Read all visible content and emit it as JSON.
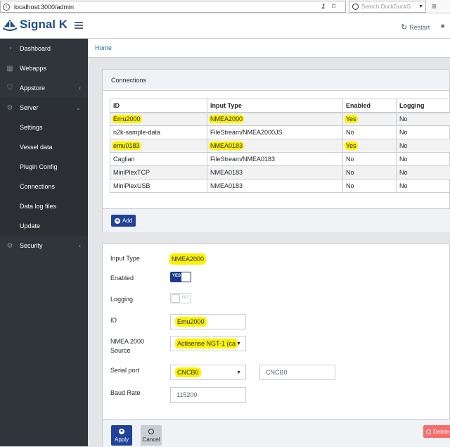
{
  "browser": {
    "url": "localhost:3000/admin",
    "search_placeholder": "Search DuckDuckG"
  },
  "header": {
    "brand": "Signal K",
    "restart": "Restart"
  },
  "sidebar": {
    "items": [
      {
        "label": "Dashboard",
        "icon": "speedometer-icon"
      },
      {
        "label": "Webapps",
        "icon": "grid-icon"
      },
      {
        "label": "Appstore",
        "icon": "basket-icon"
      },
      {
        "label": "Server",
        "icon": "gear-icon"
      },
      {
        "label": "Settings"
      },
      {
        "label": "Vessel data"
      },
      {
        "label": "Plugin Config"
      },
      {
        "label": "Connections"
      },
      {
        "label": "Data log files"
      },
      {
        "label": "Update"
      },
      {
        "label": "Security",
        "icon": "gear-icon"
      }
    ]
  },
  "breadcrumb": "Home",
  "connections": {
    "title": "Connections",
    "columns": [
      "ID",
      "Input Type",
      "Enabled",
      "Logging"
    ],
    "rows": [
      [
        "Emu2000",
        "NMEA2000",
        "Yes",
        "No"
      ],
      [
        "n2k-sample-data",
        "FileStream/NMEA2000JS",
        "No",
        "No"
      ],
      [
        "emu0183",
        "NMEA0183",
        "Yes",
        "No"
      ],
      [
        "Cagliari",
        "FileStream/NMEA0183",
        "No",
        "No"
      ],
      [
        "MiniPlexTCP",
        "NMEA0183",
        "No",
        "No"
      ],
      [
        "MiniPlexUSB",
        "NMEA0183",
        "No",
        "No"
      ]
    ],
    "add_label": "Add"
  },
  "form": {
    "input_type_label": "Input Type",
    "input_type_value": "NMEA2000",
    "enabled_label": "Enabled",
    "enabled_toggle": "YES",
    "logging_label": "Logging",
    "logging_toggle": "NO",
    "id_label": "ID",
    "id_value": "Emu2000",
    "source_label_1": "NMEA 2000",
    "source_label_2": "Source",
    "source_value": "Actisense NGT-1 (ca",
    "serial_label": "Serial port",
    "serial_value": "CNCB0",
    "serial_text": "CNCB0",
    "baud_label": "Baud Rate",
    "baud_value": "115200",
    "apply": "Apply",
    "cancel": "Cancel",
    "delete": "Delete"
  },
  "colors": {
    "highlight": "#fff200",
    "primary": "#20429a",
    "sidebar": "#2f353a",
    "danger": "#f86c6b"
  }
}
